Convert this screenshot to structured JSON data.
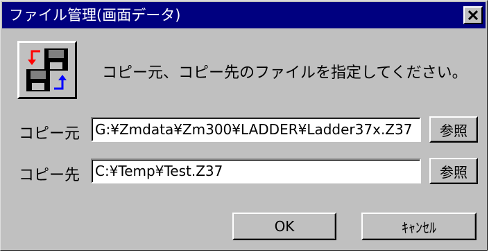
{
  "window": {
    "title": "ファイル管理(画面データ)"
  },
  "dialog": {
    "instruction": "コピー元、コピー先のファイルを指定してください。",
    "source_label": "コピー元",
    "source_value": "G:¥Zmdata¥Zm300¥LADDER¥Ladder37x.Z37",
    "dest_label": "コピー先",
    "dest_value": "C:¥Temp¥Test.Z37",
    "browse_label": "参照",
    "ok_label": "OK",
    "cancel_label": "ｷｬﾝｾﾙ"
  },
  "icons": {
    "dialog_icon": "copy-floppy-icon",
    "close_icon": "close-icon"
  },
  "colors": {
    "titlebar": "#000080",
    "face": "#c0c0c0"
  }
}
